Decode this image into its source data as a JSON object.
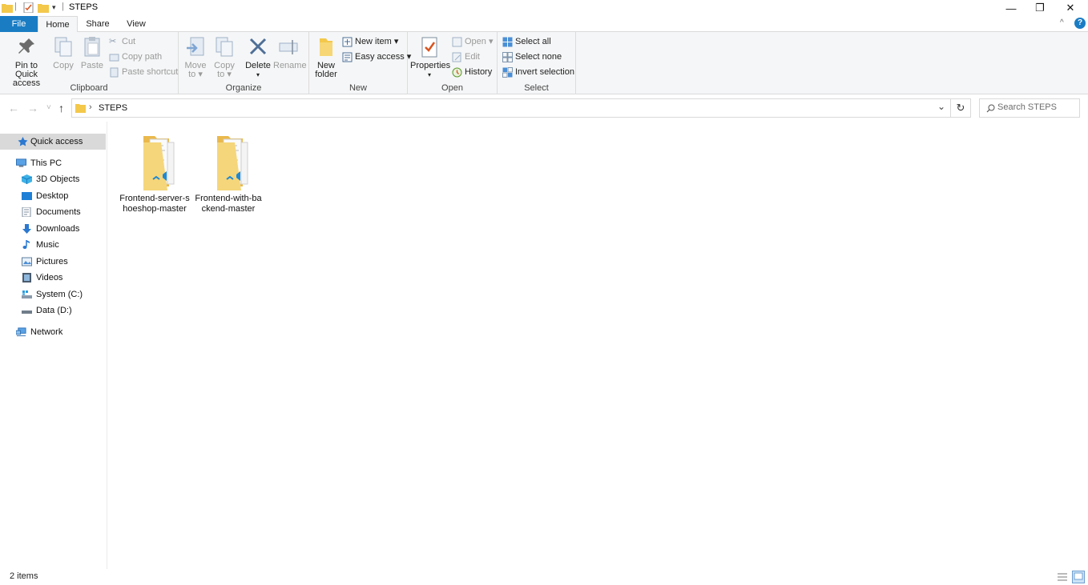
{
  "window": {
    "title": "STEPS",
    "qat_sep": "|",
    "minimize": "—",
    "restore": "❐",
    "close": "✕"
  },
  "tabs": [
    {
      "label": "File"
    },
    {
      "label": "Home"
    },
    {
      "label": "Share"
    },
    {
      "label": "View"
    }
  ],
  "ribbon_right": {
    "collapse": "^",
    "help": "?"
  },
  "ribbon": {
    "clipboard": {
      "label": "Clipboard",
      "pin_line1": "Pin to Quick",
      "pin_line2": "access",
      "copy": "Copy",
      "paste": "Paste",
      "cut": "Cut",
      "copy_path": "Copy path",
      "paste_shortcut": "Paste shortcut"
    },
    "organize": {
      "label": "Organize",
      "move_to_line1": "Move",
      "move_to_line2": "to",
      "copy_to_line1": "Copy",
      "copy_to_line2": "to",
      "delete": "Delete",
      "rename": "Rename"
    },
    "new": {
      "label": "New",
      "new_folder_line1": "New",
      "new_folder_line2": "folder",
      "new_item": "New item",
      "easy_access": "Easy access"
    },
    "open": {
      "label": "Open",
      "properties": "Properties",
      "open": "Open",
      "edit": "Edit",
      "history": "History"
    },
    "select": {
      "label": "Select",
      "select_all": "Select all",
      "select_none": "Select none",
      "invert_selection": "Invert selection"
    }
  },
  "nav": {
    "back": "←",
    "forward": "→",
    "recent": "˅",
    "up": "↑"
  },
  "address": {
    "chevron": "›",
    "path": "STEPS",
    "dropdown": "⌄",
    "refresh": "↻"
  },
  "search": {
    "placeholder": "Search STEPS"
  },
  "navpane": {
    "quick_access": "Quick access",
    "this_pc": "This PC",
    "items": [
      {
        "label": "3D Objects"
      },
      {
        "label": "Desktop"
      },
      {
        "label": "Documents"
      },
      {
        "label": "Downloads"
      },
      {
        "label": "Music"
      },
      {
        "label": "Pictures"
      },
      {
        "label": "Videos"
      },
      {
        "label": "System (C:)"
      },
      {
        "label": "Data (D:)"
      }
    ],
    "network": "Network"
  },
  "folders": [
    {
      "name": "Frontend-server-shoeshop-master"
    },
    {
      "name": "Frontend-with-backend-master"
    }
  ],
  "status": {
    "item_count": "2 items"
  },
  "colors": {
    "file_tab": "#1a7dc4",
    "folder_yellow": "#f5d67a",
    "vscode_blue": "#1e88d4",
    "selected_nav": "#d9d9d9"
  }
}
